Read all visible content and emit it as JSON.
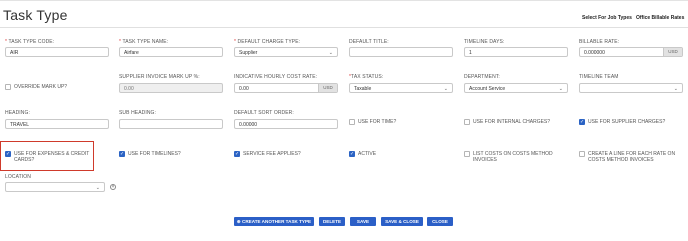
{
  "page": {
    "title": "Task Type",
    "links": {
      "select_job_types": "Select For Job Types",
      "office_billable_rates": "Office Billable Rates"
    }
  },
  "form": {
    "task_type_code": {
      "label": "TASK TYPE CODE:",
      "required": "*",
      "value": "AIR"
    },
    "task_type_name": {
      "label": "TASK TYPE NAME:",
      "required": "*",
      "value": "Airfare"
    },
    "default_charge_type": {
      "label": "DEFAULT CHARGE TYPE:",
      "required": "*",
      "value": "Supplier"
    },
    "default_title": {
      "label": "DEFAULT TITLE:",
      "value": ""
    },
    "timeline_days": {
      "label": "TIMELINE DAYS:",
      "value": "1"
    },
    "billable_rate": {
      "label": "BILLABLE RATE:",
      "value": "0.000000",
      "unit": "USD"
    },
    "override_mark_up": {
      "label": "OVERRIDE MARK UP?",
      "checked": false
    },
    "supplier_invoice_mark_up": {
      "label": "SUPPLIER INVOICE MARK UP %:",
      "value": "0.00"
    },
    "indicative_hourly_cost_rate": {
      "label": "INDICATIVE HOURLY COST RATE:",
      "value": "0.00",
      "unit": "USD"
    },
    "tax_status": {
      "label": "TAX STATUS:",
      "required": "*",
      "value": "Taxable"
    },
    "department": {
      "label": "DEPARTMENT:",
      "value": "Account Service"
    },
    "timeline_team": {
      "label": "TIMELINE TEAM",
      "value": ""
    },
    "heading": {
      "label": "HEADING:",
      "value": "TRAVEL"
    },
    "sub_heading": {
      "label": "SUB HEADING:",
      "value": ""
    },
    "default_sort_order": {
      "label": "DEFAULT SORT ORDER:",
      "value": "0.00000"
    },
    "use_for_time": {
      "label": "USE FOR TIME?",
      "checked": false
    },
    "use_for_internal_charges": {
      "label": "USE FOR INTERNAL CHARGES?",
      "checked": false
    },
    "use_for_supplier_charges": {
      "label": "USE FOR SUPPLIER CHARGES?",
      "checked": true
    },
    "use_for_expenses": {
      "label": "USE FOR EXPENSES & CREDIT CARDS?",
      "checked": true
    },
    "use_for_timelines": {
      "label": "USE FOR TIMELINES?",
      "checked": true
    },
    "service_fee_applies": {
      "label": "SERVICE FEE APPLIES?",
      "checked": true
    },
    "active": {
      "label": "ACTIVE",
      "checked": true
    },
    "list_costs": {
      "label": "LIST COSTS ON COSTS METHOD INVOICES",
      "checked": false
    },
    "create_line": {
      "label": "CREATE A LINE FOR EACH RATE ON COSTS METHOD INVOICES",
      "checked": false
    },
    "location": {
      "label": "LOCATION",
      "value": ""
    }
  },
  "buttons": {
    "create_another": "CREATE ANOTHER TASK TYPE",
    "delete": "DELETE",
    "save": "SAVE",
    "save_close": "SAVE & CLOSE",
    "close": "CLOSE"
  },
  "colors": {
    "accent": "#2b5fc7",
    "highlight": "#cf3a2b"
  }
}
